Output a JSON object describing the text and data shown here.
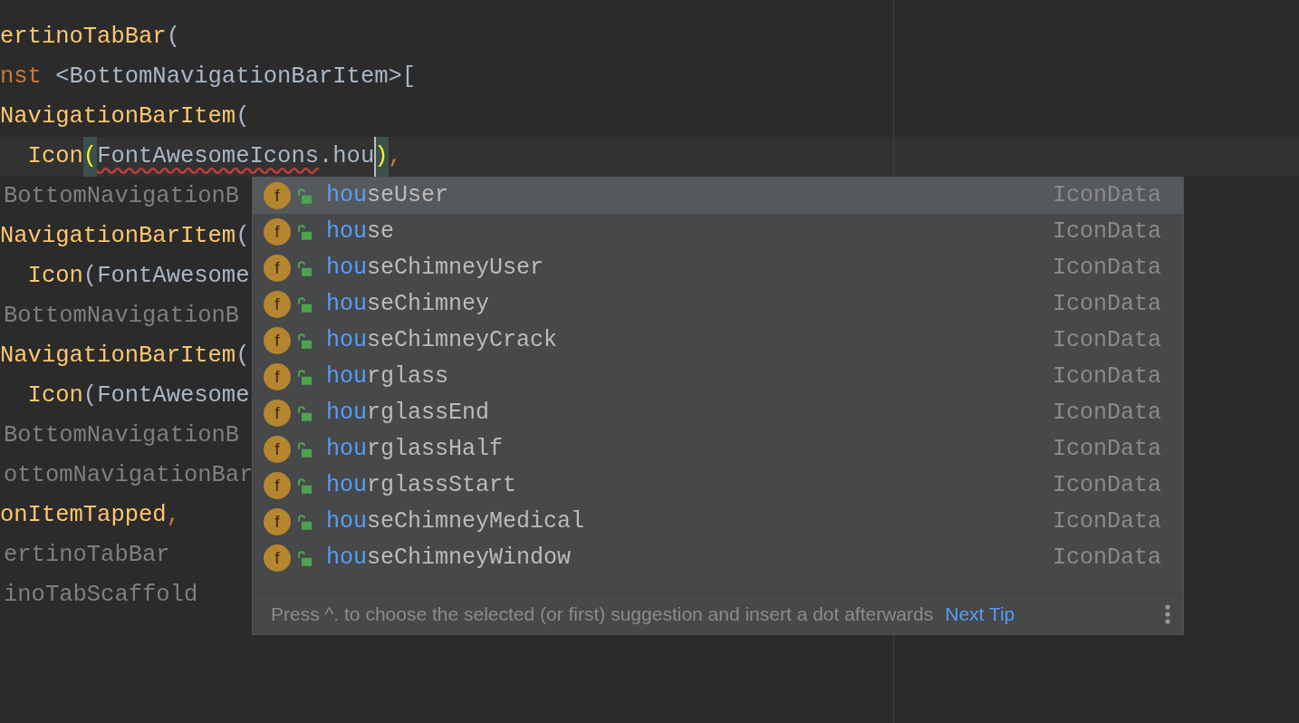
{
  "editor": {
    "lines": [
      {
        "current": false,
        "segments": [
          {
            "text": "ertinoTabBar",
            "kind": "function"
          },
          {
            "text": "(",
            "kind": "plain"
          }
        ]
      },
      {
        "current": false,
        "segments": [
          {
            "text": "nst",
            "kind": "keyword"
          },
          {
            "text": " <BottomNavigationBarItem>[",
            "kind": "plain"
          }
        ]
      },
      {
        "current": false,
        "segments": [
          {
            "text": "NavigationBarItem",
            "kind": "function"
          },
          {
            "text": "(",
            "kind": "plain"
          }
        ]
      },
      {
        "current": true,
        "segments": [
          {
            "text": "  Icon",
            "kind": "function"
          },
          {
            "text": "(",
            "kind": "paren"
          },
          {
            "text": "FontAwesomeIcons",
            "kind": "error"
          },
          {
            "text": ".hou",
            "kind": "plain"
          },
          {
            "text": ")",
            "kind": "paren-caret"
          },
          {
            "text": ",",
            "kind": "keyword"
          }
        ]
      },
      {
        "current": false,
        "segments": [
          {
            "text": "BottomNavigationB",
            "kind": "dim"
          }
        ]
      },
      {
        "current": false,
        "segments": [
          {
            "text": "NavigationBarItem",
            "kind": "function"
          },
          {
            "text": "(",
            "kind": "plain"
          }
        ]
      },
      {
        "current": false,
        "segments": [
          {
            "text": "  Icon",
            "kind": "function"
          },
          {
            "text": "(FontAwesome",
            "kind": "plain"
          }
        ]
      },
      {
        "current": false,
        "segments": [
          {
            "text": "BottomNavigationB",
            "kind": "dim"
          }
        ]
      },
      {
        "current": false,
        "segments": [
          {
            "text": "NavigationBarItem",
            "kind": "function"
          },
          {
            "text": "(",
            "kind": "plain"
          }
        ]
      },
      {
        "current": false,
        "segments": [
          {
            "text": "  Icon",
            "kind": "function"
          },
          {
            "text": "(FontAwesome",
            "kind": "plain"
          }
        ]
      },
      {
        "current": false,
        "segments": [
          {
            "text": "BottomNavigationB",
            "kind": "dim"
          }
        ]
      },
      {
        "current": false,
        "segments": [
          {
            "text": "ottomNavigationBar",
            "kind": "dim"
          }
        ]
      },
      {
        "current": false,
        "segments": [
          {
            "text": "onItemTapped",
            "kind": "function"
          },
          {
            "text": ",",
            "kind": "keyword"
          }
        ]
      },
      {
        "current": false,
        "segments": [
          {
            "text": "ertinoTabBar",
            "kind": "dim"
          }
        ]
      },
      {
        "current": false,
        "segments": [
          {
            "text": "inoTabScaffold",
            "kind": "dim"
          }
        ]
      }
    ]
  },
  "completion": {
    "items": [
      {
        "badge": "f",
        "match": "hou",
        "rest": "seUser",
        "type": "IconData",
        "selected": true
      },
      {
        "badge": "f",
        "match": "hou",
        "rest": "se",
        "type": "IconData",
        "selected": false
      },
      {
        "badge": "f",
        "match": "hou",
        "rest": "seChimneyUser",
        "type": "IconData",
        "selected": false
      },
      {
        "badge": "f",
        "match": "hou",
        "rest": "seChimney",
        "type": "IconData",
        "selected": false
      },
      {
        "badge": "f",
        "match": "hou",
        "rest": "seChimneyCrack",
        "type": "IconData",
        "selected": false
      },
      {
        "badge": "f",
        "match": "hou",
        "rest": "rglass",
        "type": "IconData",
        "selected": false
      },
      {
        "badge": "f",
        "match": "hou",
        "rest": "rglassEnd",
        "type": "IconData",
        "selected": false
      },
      {
        "badge": "f",
        "match": "hou",
        "rest": "rglassHalf",
        "type": "IconData",
        "selected": false
      },
      {
        "badge": "f",
        "match": "hou",
        "rest": "rglassStart",
        "type": "IconData",
        "selected": false
      },
      {
        "badge": "f",
        "match": "hou",
        "rest": "seChimneyMedical",
        "type": "IconData",
        "selected": false
      },
      {
        "badge": "f",
        "match": "hou",
        "rest": "seChimneyWindow",
        "type": "IconData",
        "selected": false
      }
    ],
    "hint": "Press ^. to choose the selected (or first) suggestion and insert a dot afterwards",
    "next_tip": "Next Tip"
  }
}
